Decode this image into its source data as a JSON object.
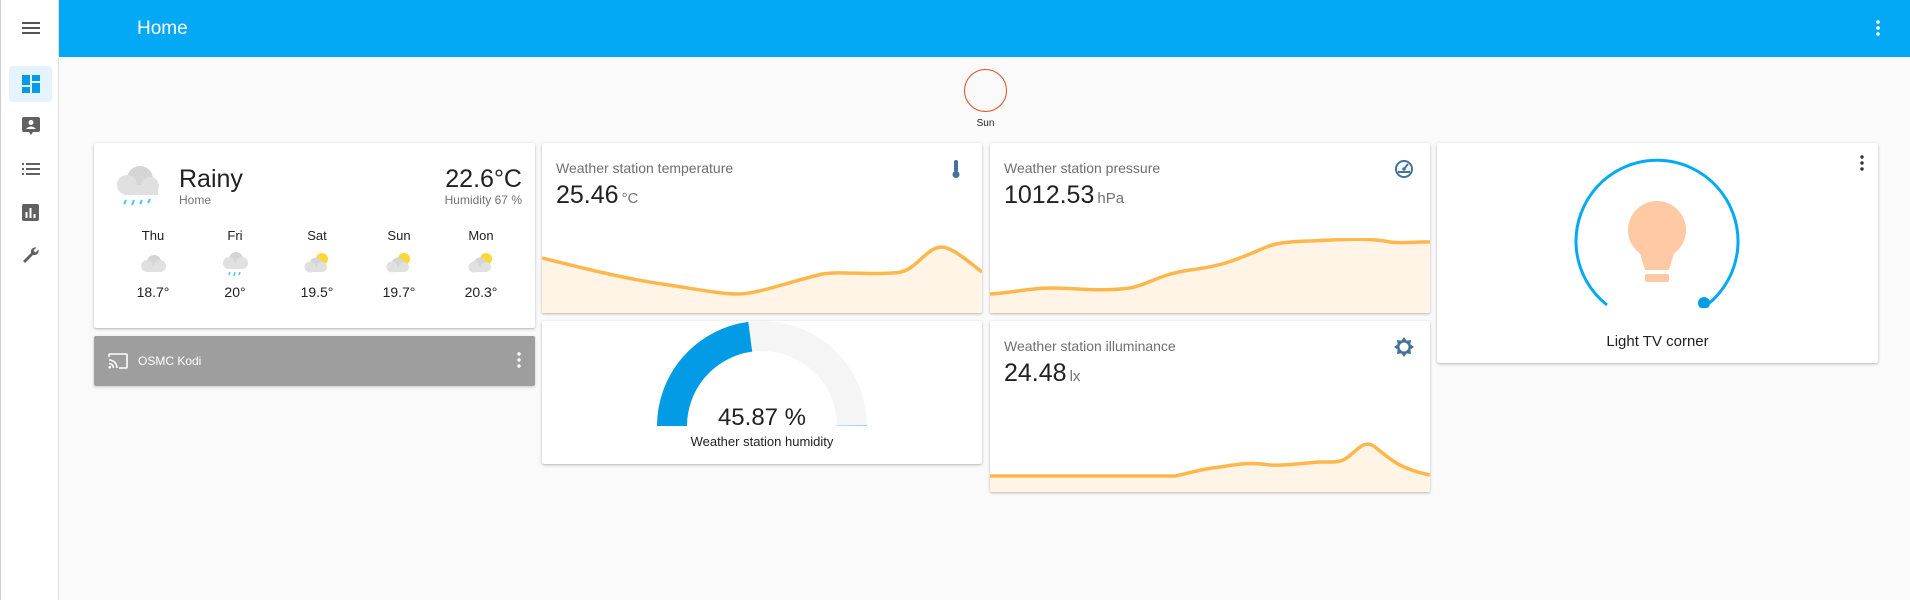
{
  "header": {
    "title": "Home"
  },
  "sun": {
    "label": "Sun"
  },
  "weather": {
    "condition": "Rainy",
    "name": "Home",
    "temperature": "22.6°C",
    "humidity": "Humidity 67 %",
    "forecast": [
      {
        "day": "Thu",
        "temp": "18.7°",
        "icon": "cloudy-icon"
      },
      {
        "day": "Fri",
        "temp": "20°",
        "icon": "rainy-icon"
      },
      {
        "day": "Sat",
        "temp": "19.5°",
        "icon": "partly-cloudy-icon"
      },
      {
        "day": "Sun",
        "temp": "19.7°",
        "icon": "partly-cloudy-icon"
      },
      {
        "day": "Mon",
        "temp": "20.3°",
        "icon": "partly-cloudy-icon"
      }
    ]
  },
  "media": {
    "name": "OSMC Kodi"
  },
  "temperature": {
    "name": "Weather station temperature",
    "value": "25.46",
    "unit": "°C"
  },
  "pressure": {
    "name": "Weather station pressure",
    "value": "1012.53",
    "unit": "hPa"
  },
  "illuminance": {
    "name": "Weather station illuminance",
    "value": "24.48",
    "unit": "lx"
  },
  "humidity": {
    "name": "Weather station humidity",
    "value": "45.87 %",
    "level": 0.4587
  },
  "light": {
    "name": "Light TV corner"
  },
  "colors": {
    "accent": "#03a9f4",
    "gauge": "#039be5",
    "spark": "#ffb74d",
    "sun_ring": "#df4c1e",
    "light_bulb": "#ffc9a3"
  }
}
